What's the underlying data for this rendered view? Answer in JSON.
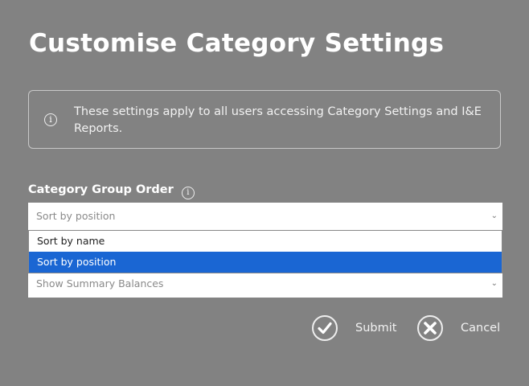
{
  "title": "Customise Category Settings",
  "notice": {
    "icon": "info-icon",
    "text": "These settings apply to all users accessing Category Settings and I&E Reports."
  },
  "category_group_order": {
    "label": "Category Group Order",
    "selected": "Sort by position",
    "options": [
      "Sort by name",
      "Sort by position"
    ]
  },
  "summary_select": {
    "value": "Show Summary Balances"
  },
  "buttons": {
    "submit": "Submit",
    "cancel": "Cancel"
  },
  "colors": {
    "background": "#828282",
    "highlight": "#1a66d3"
  }
}
